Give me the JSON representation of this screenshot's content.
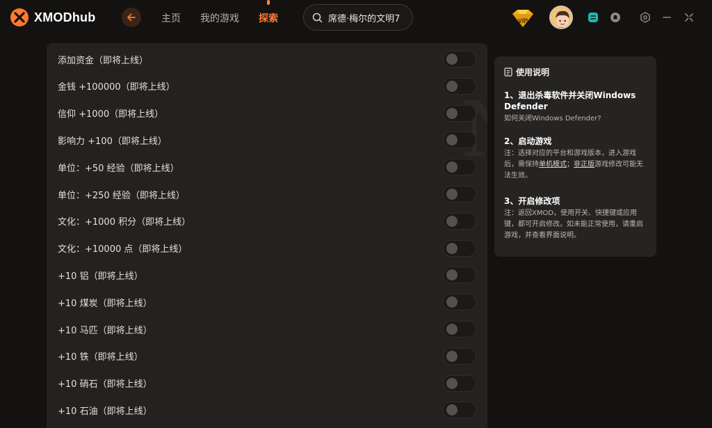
{
  "app": {
    "brand": "XMODhub",
    "brand_prefix": "XMOD",
    "brand_suffix": "hub"
  },
  "nav": {
    "home": "主页",
    "my_games": "我的游戏",
    "explore": "探索"
  },
  "search": {
    "value": "席德·梅尔的文明7"
  },
  "badges": {
    "vip": "VIP"
  },
  "cheats": [
    {
      "label": "添加资金（即将上线）",
      "enabled": false
    },
    {
      "label": "金钱 +100000（即将上线）",
      "enabled": false
    },
    {
      "label": "信仰 +1000（即将上线）",
      "enabled": false
    },
    {
      "label": "影响力 +100（即将上线）",
      "enabled": false
    },
    {
      "label": "单位：+50 经验（即将上线）",
      "enabled": false
    },
    {
      "label": "单位：+250 经验（即将上线）",
      "enabled": false
    },
    {
      "label": "文化：+1000 积分（即将上线）",
      "enabled": false
    },
    {
      "label": "文化：+10000 点（即将上线）",
      "enabled": false
    },
    {
      "label": "+10 铝（即将上线）",
      "enabled": false
    },
    {
      "label": "+10 煤炭（即将上线）",
      "enabled": false
    },
    {
      "label": "+10 马匹（即将上线）",
      "enabled": false
    },
    {
      "label": "+10 铁（即将上线）",
      "enabled": false
    },
    {
      "label": "+10 硝石（即将上线）",
      "enabled": false
    },
    {
      "label": "+10 石油（即将上线）",
      "enabled": false
    }
  ],
  "guide": {
    "title": "使用说明",
    "steps": [
      {
        "title": "1、退出杀毒软件并关闭Windows Defender",
        "desc": "如何关闭Windows Defender?"
      },
      {
        "title": "2、启动游戏",
        "desc_prefix": "注：选择对应的平台和游戏版本，进入游戏后，需保持",
        "desc_link1": "单机模式",
        "desc_mid": "；",
        "desc_link2": "非正版",
        "desc_suffix": "游戏修改可能无法生效。"
      },
      {
        "title": "3、开启修改项",
        "desc": "注：返回XMOD，使用开关、快捷键或应用键，都可开启修改。如未能正常使用，请重启游戏，并查看界面说明。"
      }
    ]
  },
  "colors": {
    "accent": "#ff7a2e",
    "background": "#131211",
    "panel": "#242220"
  }
}
